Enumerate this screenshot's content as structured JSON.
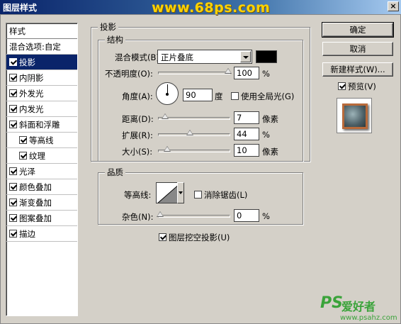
{
  "window": {
    "title": "图层样式",
    "watermark": "www.68ps.com",
    "close": "×"
  },
  "styles": {
    "header": "样式",
    "items": [
      {
        "label": "混合选项:自定",
        "checkbox": false,
        "checked": false,
        "sub": false,
        "selected": false
      },
      {
        "label": "投影",
        "checkbox": true,
        "checked": true,
        "sub": false,
        "selected": true
      },
      {
        "label": "内阴影",
        "checkbox": true,
        "checked": true,
        "sub": false,
        "selected": false
      },
      {
        "label": "外发光",
        "checkbox": true,
        "checked": true,
        "sub": false,
        "selected": false
      },
      {
        "label": "内发光",
        "checkbox": true,
        "checked": true,
        "sub": false,
        "selected": false
      },
      {
        "label": "斜面和浮雕",
        "checkbox": true,
        "checked": true,
        "sub": false,
        "selected": false
      },
      {
        "label": "等高线",
        "checkbox": true,
        "checked": true,
        "sub": true,
        "selected": false
      },
      {
        "label": "纹理",
        "checkbox": true,
        "checked": true,
        "sub": true,
        "selected": false
      },
      {
        "label": "光泽",
        "checkbox": true,
        "checked": true,
        "sub": false,
        "selected": false
      },
      {
        "label": "颜色叠加",
        "checkbox": true,
        "checked": true,
        "sub": false,
        "selected": false
      },
      {
        "label": "渐变叠加",
        "checkbox": true,
        "checked": true,
        "sub": false,
        "selected": false
      },
      {
        "label": "图案叠加",
        "checkbox": true,
        "checked": true,
        "sub": false,
        "selected": false
      },
      {
        "label": "描边",
        "checkbox": true,
        "checked": true,
        "sub": false,
        "selected": false
      }
    ]
  },
  "drop_shadow": {
    "section_title": "投影",
    "structure_title": "结构",
    "blend_mode_label": "混合模式(B):",
    "blend_mode_value": "正片叠底",
    "shadow_color": "#000000",
    "opacity_label": "不透明度(O):",
    "opacity_value": "100",
    "opacity_level": 1.0,
    "percent": "%",
    "angle_label": "角度(A):",
    "angle_value": "90",
    "angle_unit": "度",
    "global_light_label": "使用全局光(G)",
    "global_light_checked": false,
    "distance_label": "距离(D):",
    "distance_value": "7",
    "distance_level": 0.07,
    "pixels": "像素",
    "spread_label": "扩展(R):",
    "spread_value": "44",
    "spread_level": 0.44,
    "size_label": "大小(S):",
    "size_value": "10",
    "size_level": 0.1,
    "quality_title": "品质",
    "contour_label": "等高线:",
    "anti_alias_label": "消除锯齿(L)",
    "anti_alias_checked": false,
    "noise_label": "杂色(N):",
    "noise_value": "0",
    "noise_level": 0.0,
    "knockout_label": "图层挖空投影(U)",
    "knockout_checked": true
  },
  "buttons": {
    "ok": "确定",
    "cancel": "取消",
    "new_style": "新建样式(W)...",
    "preview_label": "预览(V)",
    "preview_checked": true
  },
  "branding": {
    "ps": "PS",
    "name": "爱好者",
    "url": "www.psahz.com"
  }
}
